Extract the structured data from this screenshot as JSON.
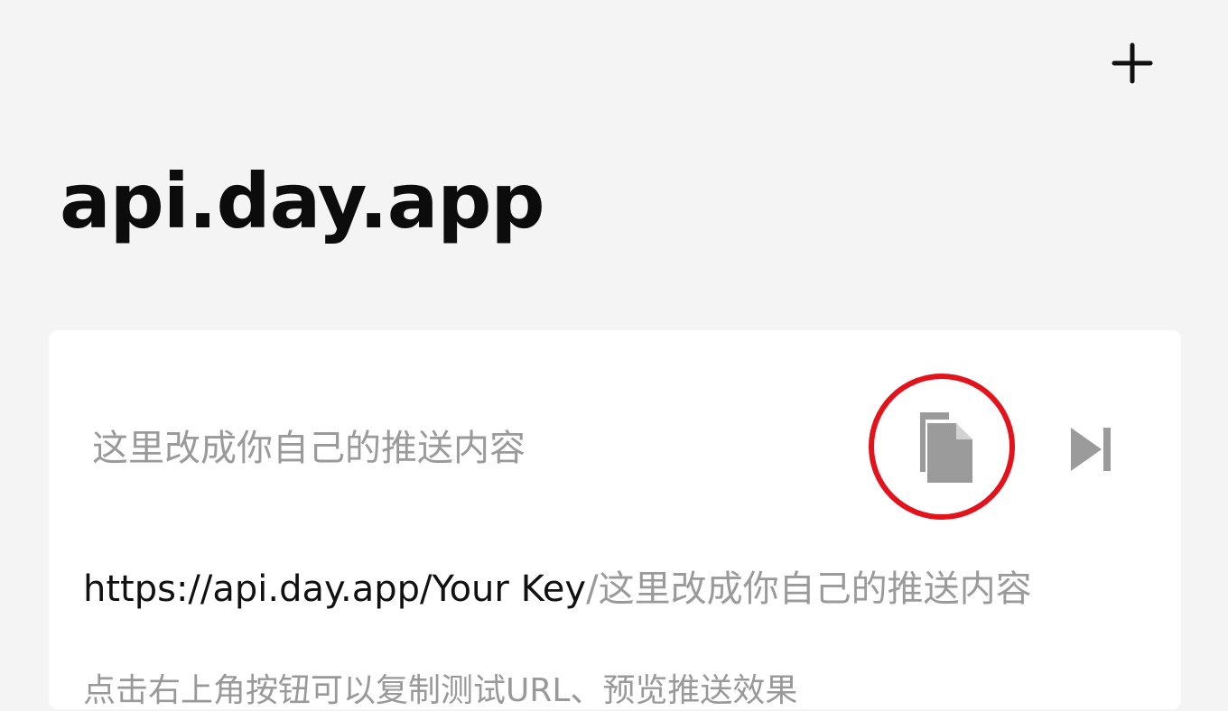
{
  "header": {
    "add_button": {
      "icon": "plus-icon",
      "label": "+"
    },
    "title": "api.day.app"
  },
  "card": {
    "push_content": "这里改成你自己的推送内容",
    "actions": {
      "copy": {
        "icon": "copy-icon",
        "highlight_color": "#e3121b"
      },
      "preview": {
        "icon": "skip-forward-icon"
      }
    },
    "url": {
      "base": "https://api.day.app/Your Key",
      "suffix": "/这里改成你自己的推送内容"
    },
    "hint": "点击右上角按钮可以复制测试URL、预览推送效果"
  },
  "colors": {
    "background": "#f4f4f4",
    "card": "#ffffff",
    "title": "#0c0c0c",
    "muted_text": "#9a9a9a",
    "icon_gray": "#9b9b9b",
    "highlight": "#e3121b"
  }
}
